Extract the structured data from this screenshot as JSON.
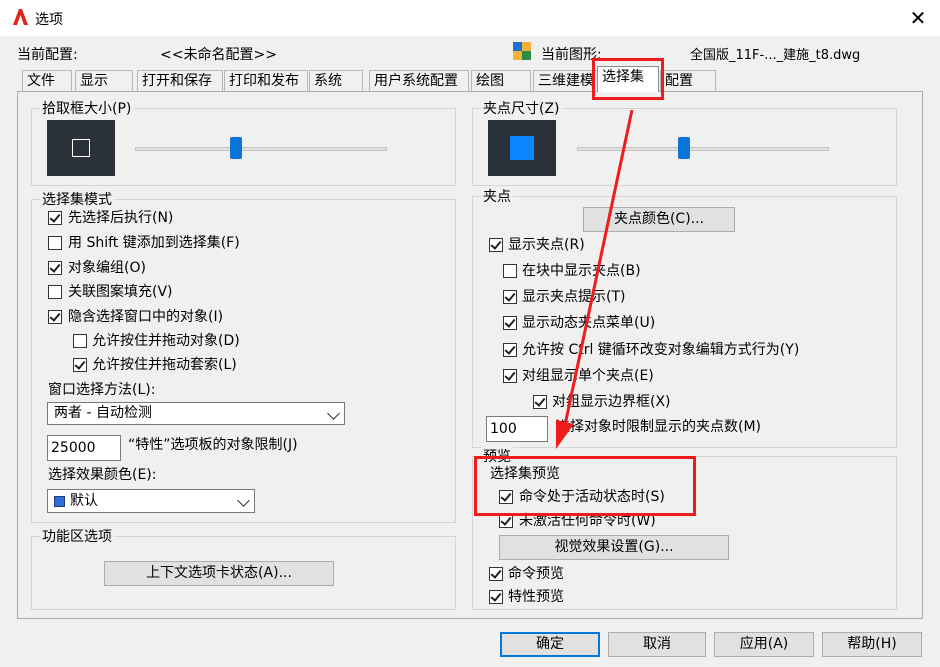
{
  "window": {
    "title": "选项",
    "close_glyph": "✕"
  },
  "header": {
    "profile_label": "当前配置:",
    "profile_value": "<<未命名配置>>",
    "drawing_label": "当前图形:",
    "drawing_value": "全国版_11F-..._建施_t8.dwg"
  },
  "tabs": [
    "文件",
    "显示",
    "打开和保存",
    "打印和发布",
    "系统",
    "用户系统配置",
    "绘图",
    "三维建模",
    "选择集",
    "配置"
  ],
  "active_tab": "选择集",
  "pickbox": {
    "title": "拾取框大小(P)",
    "slider_level": 0.4
  },
  "gripsize": {
    "title": "夹点尺寸(Z)",
    "slider_level": 0.42
  },
  "selection_modes": {
    "title": "选择集模式",
    "items": [
      {
        "label": "先选择后执行(N)",
        "checked": true
      },
      {
        "label": "用 Shift 键添加到选择集(F)",
        "checked": false
      },
      {
        "label": "对象编组(O)",
        "checked": true
      },
      {
        "label": "关联图案填充(V)",
        "checked": false
      },
      {
        "label": "隐含选择窗口中的对象(I)",
        "checked": true
      },
      {
        "label": "允许按住并拖动对象(D)",
        "checked": false
      },
      {
        "label": "允许按住并拖动套索(L)",
        "checked": true
      }
    ],
    "window_method_label": "窗口选择方法(L):",
    "window_method_value": "两者 - 自动检测",
    "limit_value": "25000",
    "limit_label": "“特性”选项板的对象限制(J)",
    "effect_color_label": "选择效果颜色(E):",
    "effect_color_value": "默认",
    "effect_color_swatch": "#2f6fd6"
  },
  "ribbon": {
    "title": "功能区选项",
    "button": "上下文选项卡状态(A)..."
  },
  "grips": {
    "title": "夹点",
    "color_button": "夹点颜色(C)...",
    "items": [
      {
        "label": "显示夹点(R)",
        "checked": true
      },
      {
        "label": "在块中显示夹点(B)",
        "checked": false
      },
      {
        "label": "显示夹点提示(T)",
        "checked": true
      },
      {
        "label": "显示动态夹点菜单(U)",
        "checked": true
      },
      {
        "label": "允许按 Ctrl 键循环改变对象编辑方式行为(Y)",
        "checked": true
      },
      {
        "label": "对组显示单个夹点(E)",
        "checked": true
      },
      {
        "label": "对组显示边界框(X)",
        "checked": true
      }
    ],
    "limit_value": "100",
    "limit_label": "选择对象时限制显示的夹点数(M)"
  },
  "preview": {
    "title": "预览",
    "subtitle": "选择集预览",
    "items": [
      {
        "label": "命令处于活动状态时(S)",
        "checked": true
      },
      {
        "label": "未激活任何命令时(W)",
        "checked": true
      }
    ],
    "visual_button": "视觉效果设置(G)...",
    "extra": [
      {
        "label": "命令预览",
        "checked": true
      },
      {
        "label": "特性预览",
        "checked": true
      }
    ]
  },
  "footer": {
    "ok": "确定",
    "cancel": "取消",
    "apply": "应用(A)",
    "help": "帮助(H)"
  },
  "colors": {
    "accent": "#0a74da",
    "highlight": "#ee1c1c",
    "preview_bg": "#2b3138",
    "grip": "#0a84ff"
  }
}
